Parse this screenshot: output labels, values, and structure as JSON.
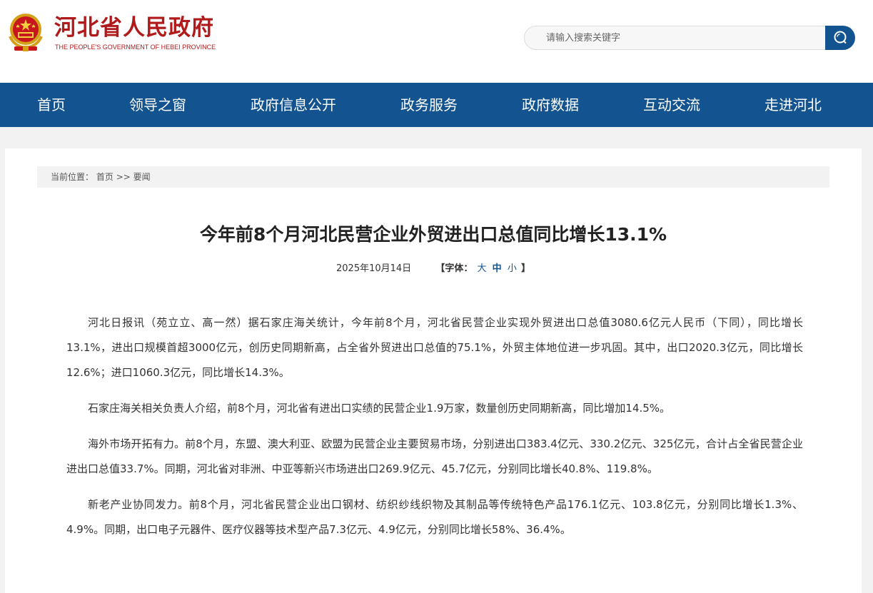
{
  "header": {
    "site_title": "河北省人民政府",
    "site_subtitle": "THE PEOPLE'S GOVERNMENT OF HEBEI PROVINCE",
    "emblem_icon": "national-emblem-icon",
    "search": {
      "placeholder": "请输入搜索关键字",
      "button_icon": "search-icon"
    }
  },
  "nav": {
    "items": [
      "首页",
      "领导之窗",
      "政府信息公开",
      "政务服务",
      "政府数据",
      "互动交流",
      "走进河北"
    ]
  },
  "breadcrumb": {
    "prefix": "当前位置：",
    "home": "首页",
    "separator": ">>",
    "current": "要闻"
  },
  "article": {
    "title": "今年前8个月河北民营企业外贸进出口总值同比增长13.1%",
    "date": "2025年10月14日",
    "font_control": {
      "open": "【",
      "label": "字体：",
      "large": "大",
      "medium": "中",
      "small": "小",
      "close": "】"
    },
    "paragraphs": [
      "河北日报讯（苑立立、高一然）据石家庄海关统计，今年前8个月，河北省民营企业实现外贸进出口总值3080.6亿元人民币（下同），同比增长13.1%，进出口规模首超3000亿元，创历史同期新高，占全省外贸进出口总值的75.1%，外贸主体地位进一步巩固。其中，出口2020.3亿元，同比增长12.6%；进口1060.3亿元，同比增长14.3%。",
      "石家庄海关相关负责人介绍，前8个月，河北省有进出口实绩的民营企业1.9万家，数量创历史同期新高，同比增加14.5%。",
      "海外市场开拓有力。前8个月，东盟、澳大利亚、欧盟为民营企业主要贸易市场，分别进出口383.4亿元、330.2亿元、325亿元，合计占全省民营企业进出口总值33.7%。同期，河北省对非洲、中亚等新兴市场进出口269.9亿元、45.7亿元，分别同比增长40.8%、119.8%。",
      "新老产业协同发力。前8个月，河北省民营企业出口钢材、纺织纱线织物及其制品等传统特色产品176.1亿元、103.8亿元，分别同比增长1.3%、4.9%。同期，出口电子元器件、医疗仪器等技术型产品7.3亿元、4.9亿元，分别同比增长58%、36.4%。"
    ]
  },
  "colors": {
    "brand_red": "#b11a1a",
    "nav_blue": "#13538f",
    "page_bg": "#f2f2f2"
  }
}
